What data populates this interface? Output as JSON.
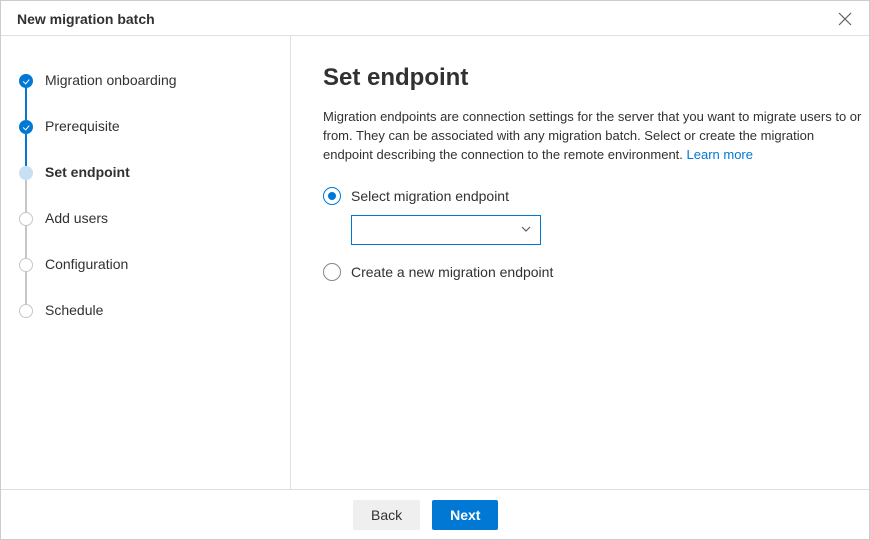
{
  "window_title": "New migration batch",
  "steps": [
    {
      "label": "Migration onboarding",
      "state": "complete"
    },
    {
      "label": "Prerequisite",
      "state": "complete"
    },
    {
      "label": "Set endpoint",
      "state": "current"
    },
    {
      "label": "Add users",
      "state": "upcoming"
    },
    {
      "label": "Configuration",
      "state": "upcoming"
    },
    {
      "label": "Schedule",
      "state": "upcoming"
    }
  ],
  "main": {
    "heading": "Set endpoint",
    "description_text": "Migration endpoints are connection settings for the server that you want to migrate users to or from. They can be associated with any migration batch. Select or create the migration endpoint describing the connection to the remote environment. ",
    "learn_more_label": "Learn more",
    "radio_select_label": "Select migration endpoint",
    "radio_create_label": "Create a new migration endpoint",
    "selected_option": "select",
    "dropdown_value": ""
  },
  "footer": {
    "back_label": "Back",
    "next_label": "Next"
  }
}
